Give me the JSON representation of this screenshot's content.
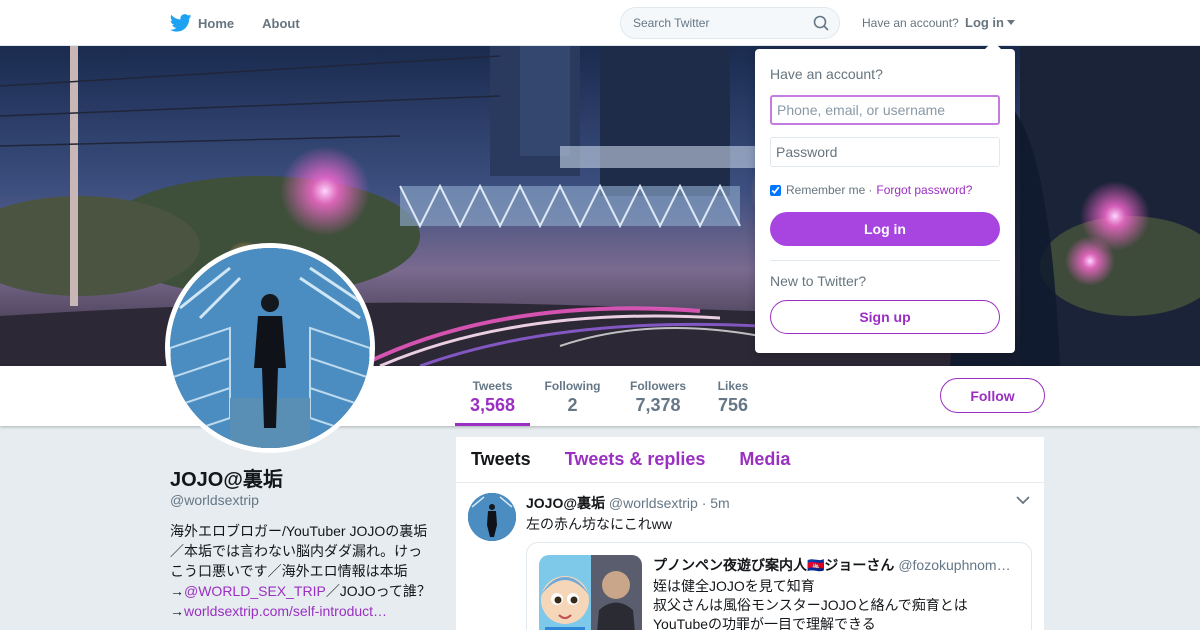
{
  "nav": {
    "home_label": "Home",
    "about_label": "About",
    "search_placeholder": "Search Twitter",
    "have_account": "Have an account?",
    "login_label": "Log in"
  },
  "profile": {
    "name": "JOJO@裏垢",
    "handle": "@worldsextrip",
    "bio_text_1": "海外エロブロガー/YouTuber JOJOの裏垢／本垢では言わない脳内ダダ漏れ。けっこう口悪いです／海外エロ情報は本垢→",
    "bio_link_1": "@WORLD_SEX_TRIP",
    "bio_text_2": "／JOJOって誰？→",
    "bio_link_2": "worldsextrip.com/self-introduct…",
    "follow_label": "Follow"
  },
  "stats": [
    {
      "label": "Tweets",
      "value": "3,568"
    },
    {
      "label": "Following",
      "value": "2"
    },
    {
      "label": "Followers",
      "value": "7,378"
    },
    {
      "label": "Likes",
      "value": "756"
    }
  ],
  "timeline": {
    "tabs": [
      "Tweets",
      "Tweets & replies",
      "Media"
    ],
    "tweet": {
      "name": "JOJO@裏垢",
      "handle": "@worldsextrip",
      "time": "· 5m",
      "text": "左の赤ん坊なにこれww",
      "quote": {
        "name": "プノンペン夜遊び案内人🇰🇭ジョーさん",
        "handle": "@fozokuphnom…",
        "line1": "姪は健全JOJOを見て知育",
        "line2": "叔父さんは風俗モンスターJOJOと絡んで痴育とは",
        "line3": "YouTubeの功罪が一目で理解できる"
      }
    }
  },
  "login_dropdown": {
    "title": "Have an account?",
    "username_placeholder": "Phone, email, or username",
    "password_placeholder": "Password",
    "remember_label": "Remember me",
    "separator": "·",
    "forgot_label": "Forgot password?",
    "login_button": "Log in",
    "new_label": "New to Twitter?",
    "signup_button": "Sign up"
  },
  "colors": {
    "accent": "#9b2fc2",
    "accent_button": "#a845e0",
    "text_muted": "#657786"
  }
}
